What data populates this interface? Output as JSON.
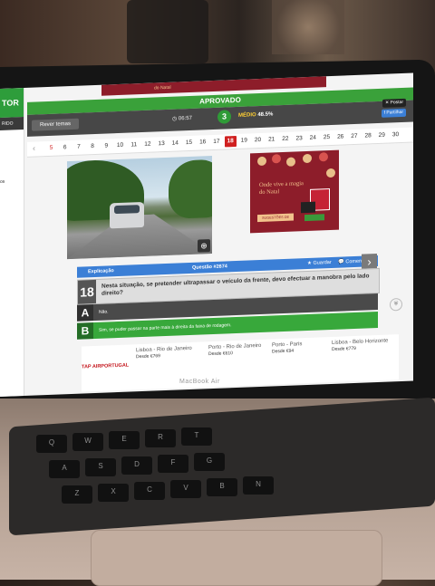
{
  "sidebar": {
    "brand": "TOR",
    "items": [
      "RIDO",
      "os"
    ]
  },
  "top_ad_text": "do Natal",
  "status": {
    "title": "APROVADO",
    "review_label": "Rever temas",
    "timer": "06:57",
    "score": "3",
    "medio_label": "MÉDIO",
    "medio_pct": "48.5%",
    "tweet_label": "Postar",
    "share_label": "Partilhar"
  },
  "question_nav": {
    "numbers": [
      "5",
      "6",
      "7",
      "8",
      "9",
      "10",
      "11",
      "12",
      "13",
      "14",
      "15",
      "16",
      "17",
      "18",
      "19",
      "20",
      "21",
      "22",
      "23",
      "24",
      "25",
      "26",
      "27",
      "28",
      "29",
      "30"
    ],
    "wrong": [
      "5"
    ],
    "current": "18"
  },
  "side_ad": {
    "title": "Onde vive a magia do Natal",
    "button": "SUGESTÕES DE PRESENTES"
  },
  "question_header": {
    "explain_label": "Explicação",
    "question_title": "Questão #2674",
    "save_label": "Guardar",
    "comments_label": "Comentários"
  },
  "question": {
    "number": "18",
    "text": "Nesta situação, se pretender ultrapassar o veículo da frente, devo efectuar a manobra pelo lado direito?"
  },
  "answers": [
    {
      "letter": "A",
      "text": "Não."
    },
    {
      "letter": "B",
      "text": "Sim, se puder passar na parte mais à direita da faixa de rodagem."
    }
  ],
  "flight_ad": {
    "logo": "TAP AIRPORTUGAL",
    "flights": [
      {
        "route": "Lisboa - Rio de Janeiro",
        "price": "Desde €769"
      },
      {
        "route": "Porto - Rio de Janeiro",
        "price": "Desde €610"
      },
      {
        "route": "Porto - Paris",
        "price": "Desde €94"
      },
      {
        "route": "Lisboa - Belo Horizonte",
        "price": "Desde €779"
      }
    ]
  },
  "laptop_label": "MacBook Air",
  "keys": [
    "Q",
    "W",
    "E",
    "R",
    "T",
    "A",
    "S",
    "D",
    "F",
    "G",
    "Z",
    "X",
    "C",
    "V",
    "B",
    "N"
  ]
}
